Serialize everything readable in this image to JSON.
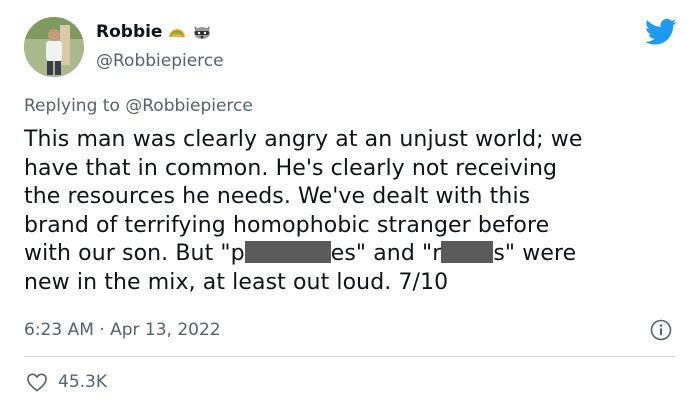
{
  "author": {
    "display_name": "Robbie",
    "handle": "@Robbiepierce",
    "badges": [
      "taco-emoji",
      "raccoon-emoji"
    ]
  },
  "reply": {
    "prefix": "Replying to",
    "mention": "@Robbiepierce"
  },
  "tweet": {
    "line_1": "This man was clearly angry at an unjust world; we",
    "line_2": "have that in common. He's clearly not receiving",
    "line_3": "the resources he needs. We've dealt with this",
    "line_4": "brand of terrifying homophobic stranger before",
    "line_5a": "with our son. But \"p",
    "line_5b": "es\" and \"r",
    "line_5c": "s\" were",
    "line_6": "new in the mix, at least out loud. 7/10"
  },
  "meta": {
    "timestamp": "6:23 AM · Apr 13, 2022"
  },
  "stats": {
    "likes": "45.3K"
  },
  "colors": {
    "twitter_blue": "#1d9bf0",
    "secondary_text": "#536471",
    "divider": "#cfd9de",
    "redaction": "#5a5a5a"
  }
}
